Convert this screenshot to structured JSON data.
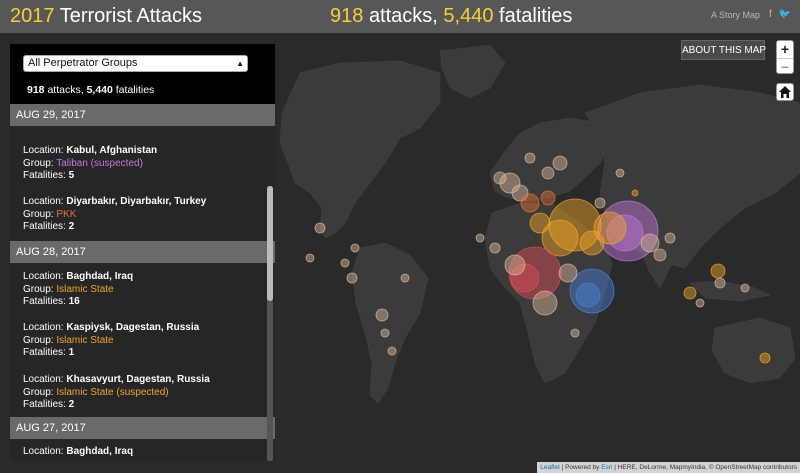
{
  "header": {
    "title_highlight": "2017",
    "title_rest": "Terrorist Attacks",
    "attacks": "918",
    "attacks_label": "attacks,",
    "fatalities": "5,440",
    "fatalities_label": "fatalities",
    "storymap_label": "A Story Map",
    "social_icons": [
      "facebook-icon",
      "twitter-icon"
    ]
  },
  "map": {
    "about_label": "ABOUT THIS MAP",
    "zoom_in": "+",
    "zoom_out": "−",
    "home_icon": "home-icon",
    "attribution_leaflet": "Leaflet",
    "attribution_sep": " | Powered by ",
    "attribution_esri": "Esri",
    "attribution_rest": " | HERE, DeLorme, MapmyIndia, © OpenStreetMap contributors",
    "group_colors": {
      "Islamic State": "#f5a623",
      "Taliban": "#c678dd",
      "PKK": "#e8723a",
      "Boko Haram": "#e04b58",
      "al-Shabaab": "#4a7fd8",
      "other": "#d9b99b"
    }
  },
  "sidebar": {
    "filter_value": "All Perpetrator Groups",
    "count_attacks": "918",
    "count_attacks_label": "attacks,",
    "count_fatalities": "5,440",
    "count_fatalities_label": "fatalities",
    "labels": {
      "location": "Location:",
      "group": "Group:",
      "fatalities": "Fatalities:"
    },
    "days": [
      {
        "date": "AUG 29, 2017",
        "entries": [
          {
            "location": "Kabul, Afghanistan",
            "group": "Taliban (suspected)",
            "group_color": "#c678dd",
            "fatalities": "5"
          },
          {
            "location": "Diyarbakır, Diyarbakır, Turkey",
            "group": "PKK",
            "group_color": "#e8723a",
            "fatalities": "2"
          }
        ]
      },
      {
        "date": "AUG 28, 2017",
        "entries": [
          {
            "location": "Baghdad, Iraq",
            "group": "Islamic State",
            "group_color": "#f5a623",
            "fatalities": "16"
          },
          {
            "location": "Kaspiysk, Dagestan, Russia",
            "group": "Islamic State",
            "group_color": "#f5a623",
            "fatalities": "1"
          },
          {
            "location": "Khasavyurt, Dagestan, Russia",
            "group": "Islamic State (suspected)",
            "group_color": "#f5a623",
            "fatalities": "2"
          }
        ]
      },
      {
        "date": "AUG 27, 2017",
        "entries": [
          {
            "location": "Baghdad, Iraq"
          }
        ]
      }
    ]
  }
}
